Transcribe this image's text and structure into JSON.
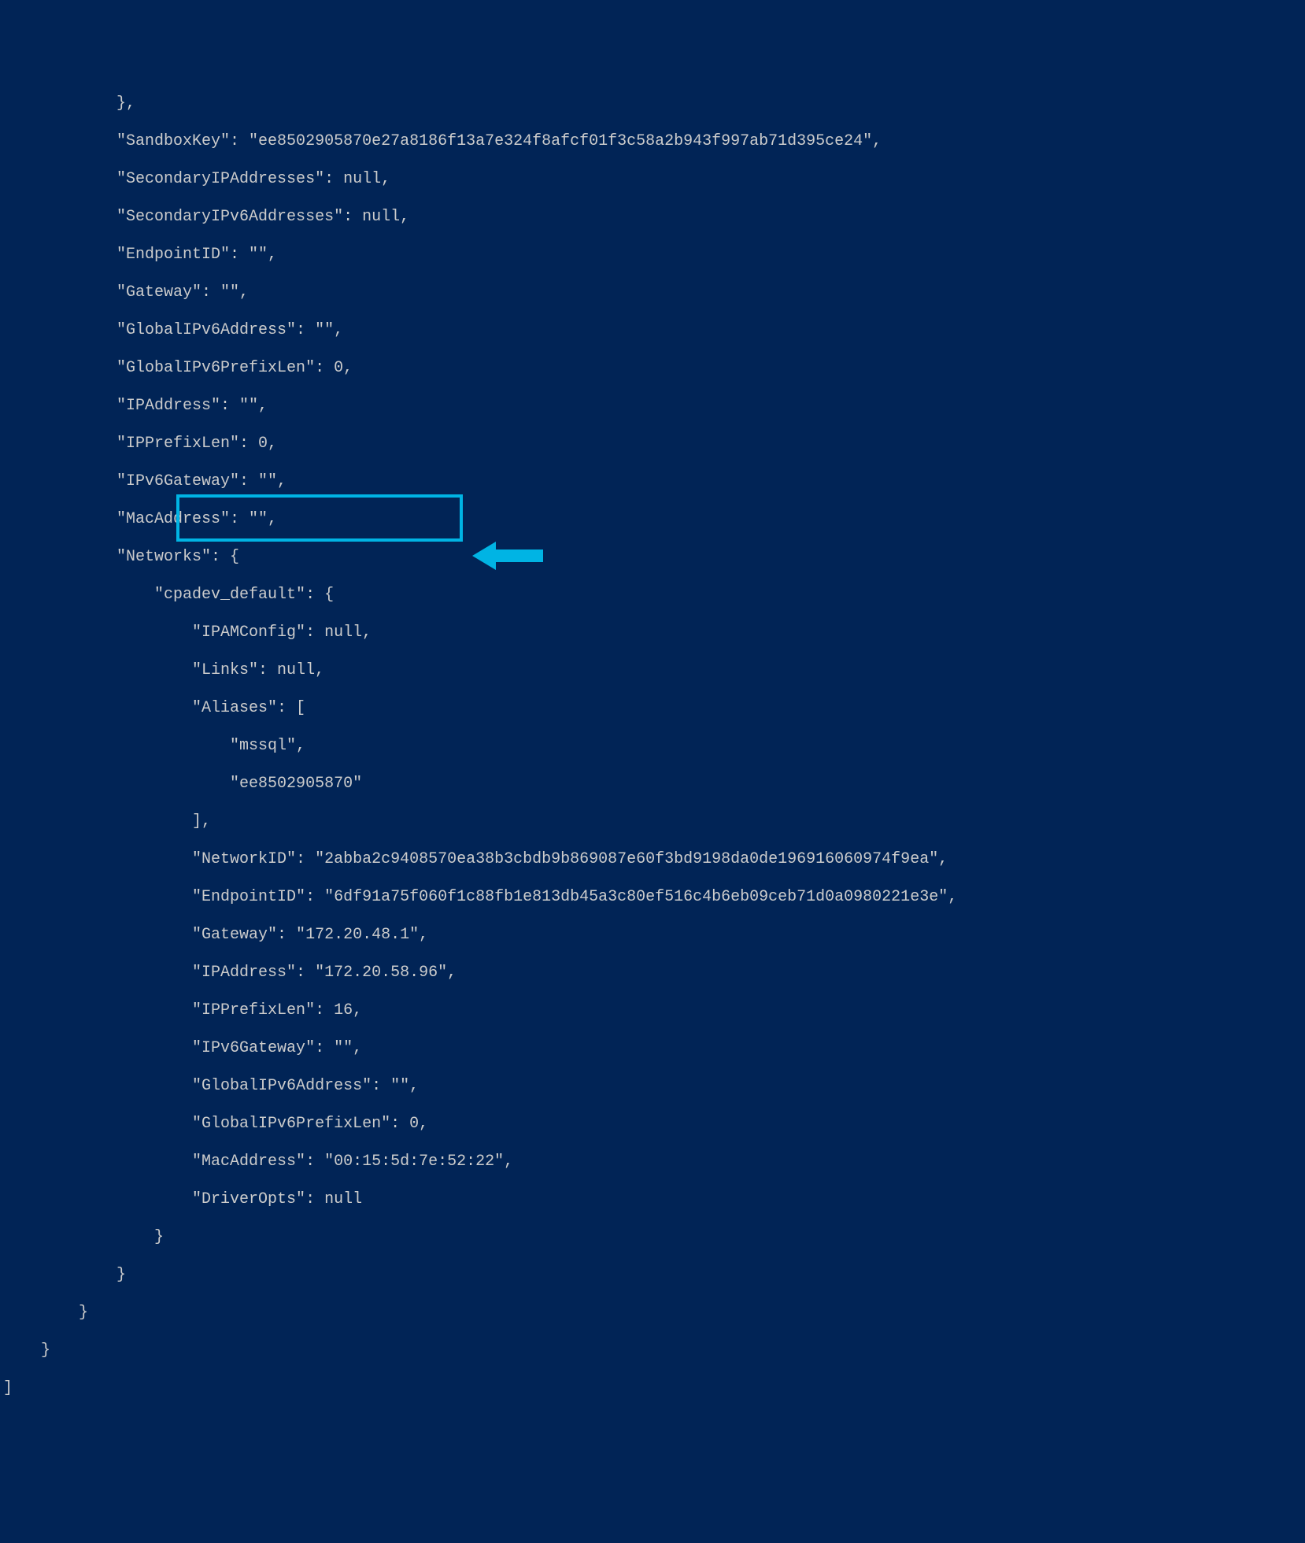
{
  "annotation": {
    "highlight_color": "#00b4e4",
    "arrow_color": "#00b4e4"
  },
  "lines": {
    "l0": "            },",
    "l1": "            \"SandboxKey\": \"ee8502905870e27a8186f13a7e324f8afcf01f3c58a2b943f997ab71d395ce24\",",
    "l2": "            \"SecondaryIPAddresses\": null,",
    "l3": "            \"SecondaryIPv6Addresses\": null,",
    "l4": "            \"EndpointID\": \"\",",
    "l5": "            \"Gateway\": \"\",",
    "l6": "            \"GlobalIPv6Address\": \"\",",
    "l7": "            \"GlobalIPv6PrefixLen\": 0,",
    "l8": "            \"IPAddress\": \"\",",
    "l9": "            \"IPPrefixLen\": 0,",
    "l10": "            \"IPv6Gateway\": \"\",",
    "l11": "            \"MacAddress\": \"\",",
    "l12": "            \"Networks\": {",
    "l13": "                \"cpadev_default\": {",
    "l14": "                    \"IPAMConfig\": null,",
    "l15": "                    \"Links\": null,",
    "l16": "                    \"Aliases\": [",
    "l17": "                        \"mssql\",",
    "l18": "                        \"ee8502905870\"",
    "l19": "                    ],",
    "l20": "                    \"NetworkID\": \"2abba2c9408570ea38b3cbdb9b869087e60f3bd9198da0de196916060974f9ea\",",
    "l21": "                    \"EndpointID\": \"6df91a75f060f1c88fb1e813db45a3c80ef516c4b6eb09ceb71d0a0980221e3e\",",
    "l22_hidden": "                    \"Gateway\": \"172.20.48.1\",",
    "l23": "                    \"IPAddress\": \"172.20.58.96\",",
    "l24_hidden": "                    \"IPPrefixLen\": 16,",
    "l25": "                    \"IPv6Gateway\": \"\",",
    "l26": "                    \"GlobalIPv6Address\": \"\",",
    "l27": "                    \"GlobalIPv6PrefixLen\": 0,",
    "l28": "                    \"MacAddress\": \"00:15:5d:7e:52:22\",",
    "l29": "                    \"DriverOpts\": null",
    "l30": "                }",
    "l31": "            }",
    "l32": "        }",
    "l33": "    }",
    "l34": "]"
  }
}
